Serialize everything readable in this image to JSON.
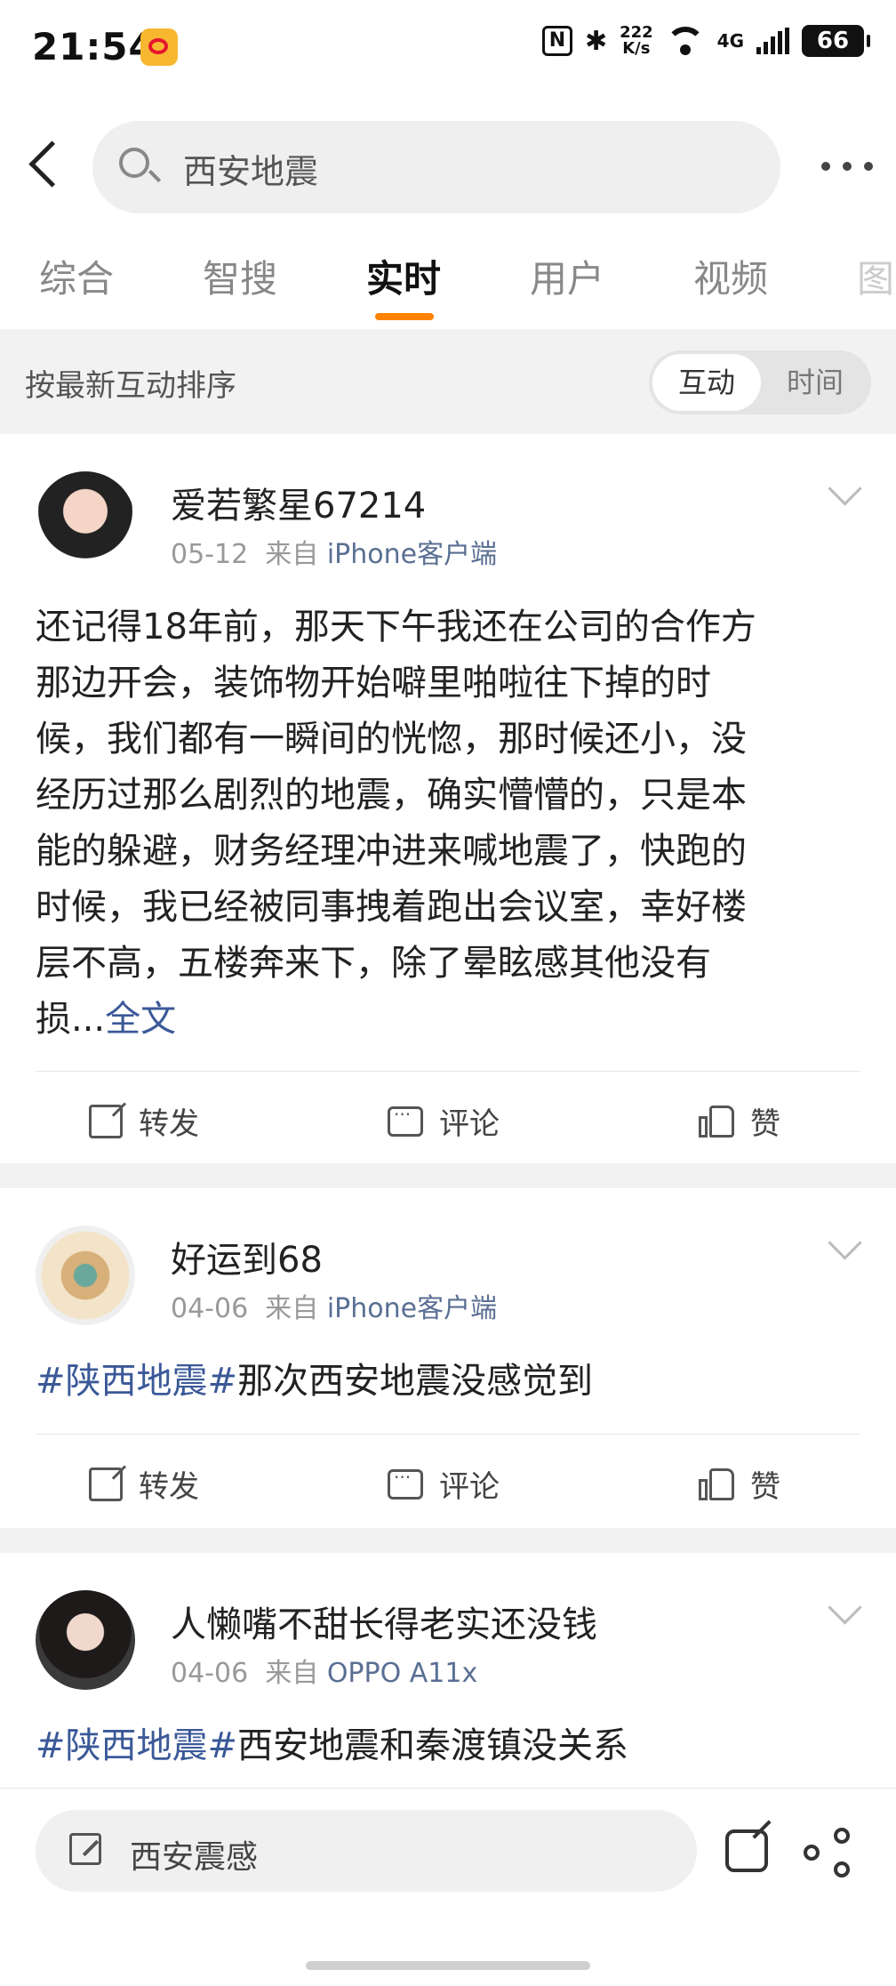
{
  "status_bar": {
    "time": "21:54",
    "net_speed_value": "222",
    "net_speed_unit": "K/s",
    "network": "4G",
    "battery": "66"
  },
  "search": {
    "query": "西安地震"
  },
  "tabs": [
    {
      "label": "综合"
    },
    {
      "label": "智搜"
    },
    {
      "label": "实时"
    },
    {
      "label": "用户"
    },
    {
      "label": "视频"
    },
    {
      "label": "图"
    }
  ],
  "active_tab": "实时",
  "sort": {
    "label": "按最新互动排序",
    "options": [
      "互动",
      "时间"
    ],
    "selected": "互动"
  },
  "posts": [
    {
      "username": "爱若繁星67214",
      "date": "05-12",
      "source_prefix": "来自",
      "source": "iPhone客户端",
      "text_lines": [
        "还记得18年前，那天下午我还在公司的合作方",
        "那边开会，装饰物开始噼里啪啦往下掉的时",
        "候，我们都有一瞬间的恍惚，那时候还小，没",
        "经历过那么剧烈的地震，确实懵懵的，只是本",
        "能的躲避，财务经理冲进来喊地震了，快跑的",
        "时候，我已经被同事拽着跑出会议室，幸好楼",
        "层不高，五楼奔来下，除了晕眩感其他没有",
        "损..."
      ],
      "more_link": "全文",
      "actions": {
        "repost": "转发",
        "comment": "评论",
        "like": "赞"
      }
    },
    {
      "username": "好运到68",
      "date": "04-06",
      "source_prefix": "来自",
      "source": "iPhone客户端",
      "hashtag": "#陕西地震#",
      "text": "那次西安地震没感觉到",
      "actions": {
        "repost": "转发",
        "comment": "评论",
        "like": "赞"
      }
    },
    {
      "username": "人懒嘴不甜长得老实还没钱",
      "date": "04-06",
      "source_prefix": "来自",
      "source": "OPPO A11x",
      "hashtag": "#陕西地震#",
      "text": "西安地震和秦渡镇没关系"
    }
  ],
  "bottom_bar": {
    "comment_placeholder": "西安震感"
  },
  "colors": {
    "accent": "#ff8200",
    "link": "#3b5998",
    "source": "#5a6f93"
  },
  "icons": [
    "search-icon",
    "back-icon",
    "more-icon",
    "chevron-down-icon",
    "repost-icon",
    "comment-icon",
    "like-icon",
    "pencil-icon",
    "edit-icon",
    "share-icon"
  ]
}
